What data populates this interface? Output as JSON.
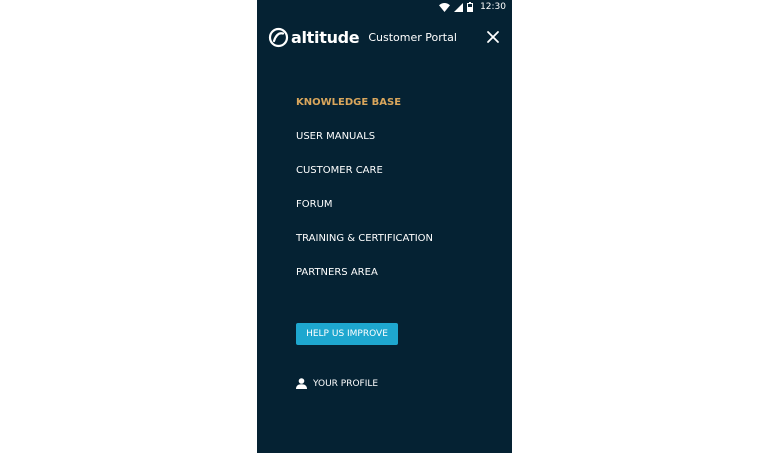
{
  "status_bar": {
    "time": "12:30",
    "icons": [
      "wifi-icon",
      "signal-icon",
      "battery-icon"
    ]
  },
  "header": {
    "brand_name": "altitude",
    "portal_label": "Customer Portal",
    "close_icon": "close-icon"
  },
  "menu": {
    "items": [
      {
        "label": "KNOWLEDGE BASE",
        "active": true
      },
      {
        "label": "USER MANUALS",
        "active": false
      },
      {
        "label": "CUSTOMER CARE",
        "active": false
      },
      {
        "label": "FORUM",
        "active": false
      },
      {
        "label": "TRAINING & CERTIFICATION",
        "active": false
      },
      {
        "label": "PARTNERS AREA",
        "active": false
      }
    ]
  },
  "help_button": {
    "label": "HELP US IMPROVE"
  },
  "profile": {
    "label": "YOUR PROFILE",
    "icon": "user-icon"
  },
  "colors": {
    "background": "#052233",
    "active_item": "#d9a65c",
    "button": "#1ea7cf",
    "text": "#ffffff"
  }
}
